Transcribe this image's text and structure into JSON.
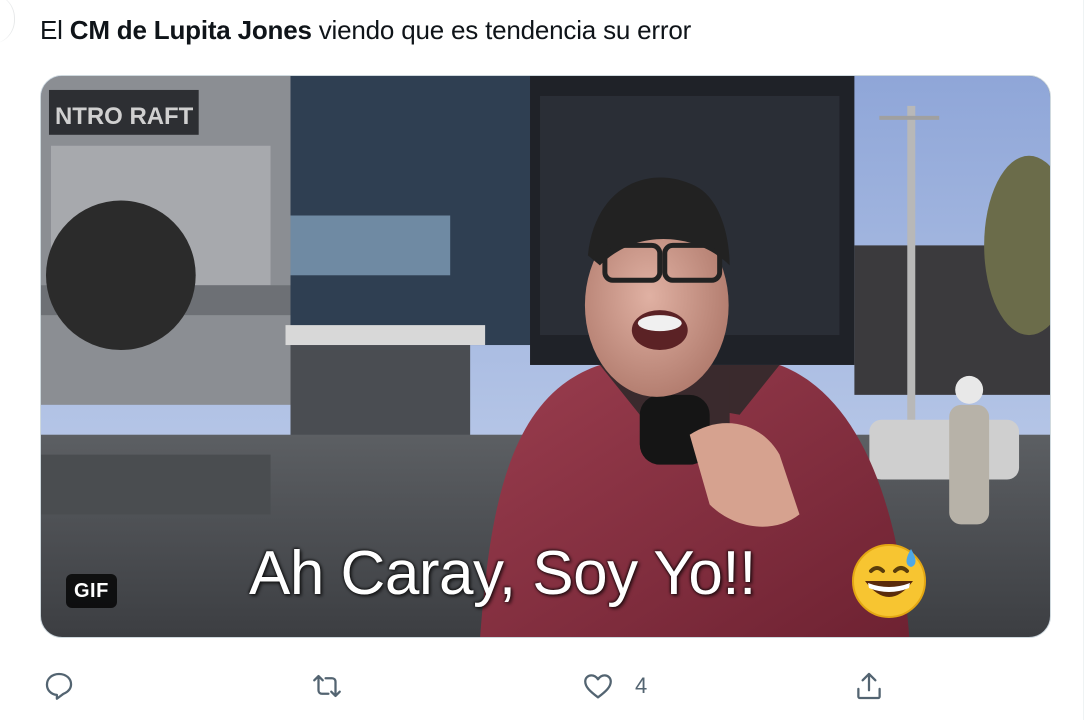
{
  "tweet": {
    "text_prefix": "El ",
    "text_bold": "CM de Lupita Jones",
    "text_suffix": " viendo que es tendencia su error"
  },
  "media": {
    "type": "gif",
    "gif_badge": "GIF",
    "caption": "Ah Caray, Soy Yo!!",
    "sign_text": "NTRO RAFT",
    "emoji": "grinning-face-with-sweat"
  },
  "actions": {
    "reply_icon": "reply-icon",
    "retweet_icon": "retweet-icon",
    "like_icon": "heart-icon",
    "like_count": "4",
    "share_icon": "share-icon"
  },
  "colors": {
    "text": "#0f1419",
    "action_gray": "#536471",
    "media_border": "#cfd9de"
  }
}
